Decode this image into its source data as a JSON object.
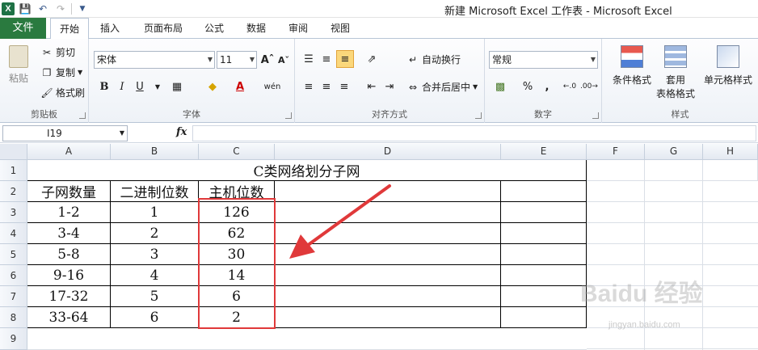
{
  "window": {
    "title": "新建 Microsoft Excel 工作表 - Microsoft Excel",
    "app_badge": "X"
  },
  "tabs": {
    "file": "文件",
    "items": [
      "开始",
      "插入",
      "页面布局",
      "公式",
      "数据",
      "审阅",
      "视图"
    ],
    "active": "开始"
  },
  "ribbon": {
    "clipboard": {
      "paste": "粘贴",
      "cut": "剪切",
      "copy": "复制",
      "format_painter": "格式刷",
      "label": "剪贴板"
    },
    "font": {
      "name": "宋体",
      "size": "11",
      "bold": "B",
      "italic": "I",
      "underline": "U",
      "label": "字体"
    },
    "alignment": {
      "wrap": "自动换行",
      "merge": "合并后居中",
      "label": "对齐方式"
    },
    "number": {
      "format": "常规",
      "percent": "%",
      "comma": ",",
      "label": "数字"
    },
    "styles": {
      "conditional": "条件格式",
      "table_line1": "套用",
      "table_line2": "表格格式",
      "cell_styles": "单元格样式",
      "label": "样式"
    }
  },
  "formula_bar": {
    "name_box": "I19",
    "fx": "fx",
    "content": ""
  },
  "sheet": {
    "columns": [
      "A",
      "B",
      "C",
      "D",
      "E",
      "F",
      "G",
      "H"
    ],
    "rows": [
      "1",
      "2",
      "3",
      "4",
      "5",
      "6",
      "7",
      "8",
      "9"
    ],
    "title": "C类网络划分子网",
    "headers": [
      "子网数量",
      "二进制位数",
      "主机位数"
    ],
    "data": [
      [
        "1-2",
        "1",
        "126"
      ],
      [
        "3-4",
        "2",
        "62"
      ],
      [
        "5-8",
        "3",
        "30"
      ],
      [
        "9-16",
        "4",
        "14"
      ],
      [
        "17-32",
        "5",
        "6"
      ],
      [
        "33-64",
        "6",
        "2"
      ]
    ]
  },
  "watermark": {
    "brand": "Baidu 经验",
    "url": "jingyan.baidu.com"
  },
  "colors": {
    "file_tab": "#2a7a3f",
    "highlight_box": "#e0393a",
    "arrow": "#e0393a"
  }
}
